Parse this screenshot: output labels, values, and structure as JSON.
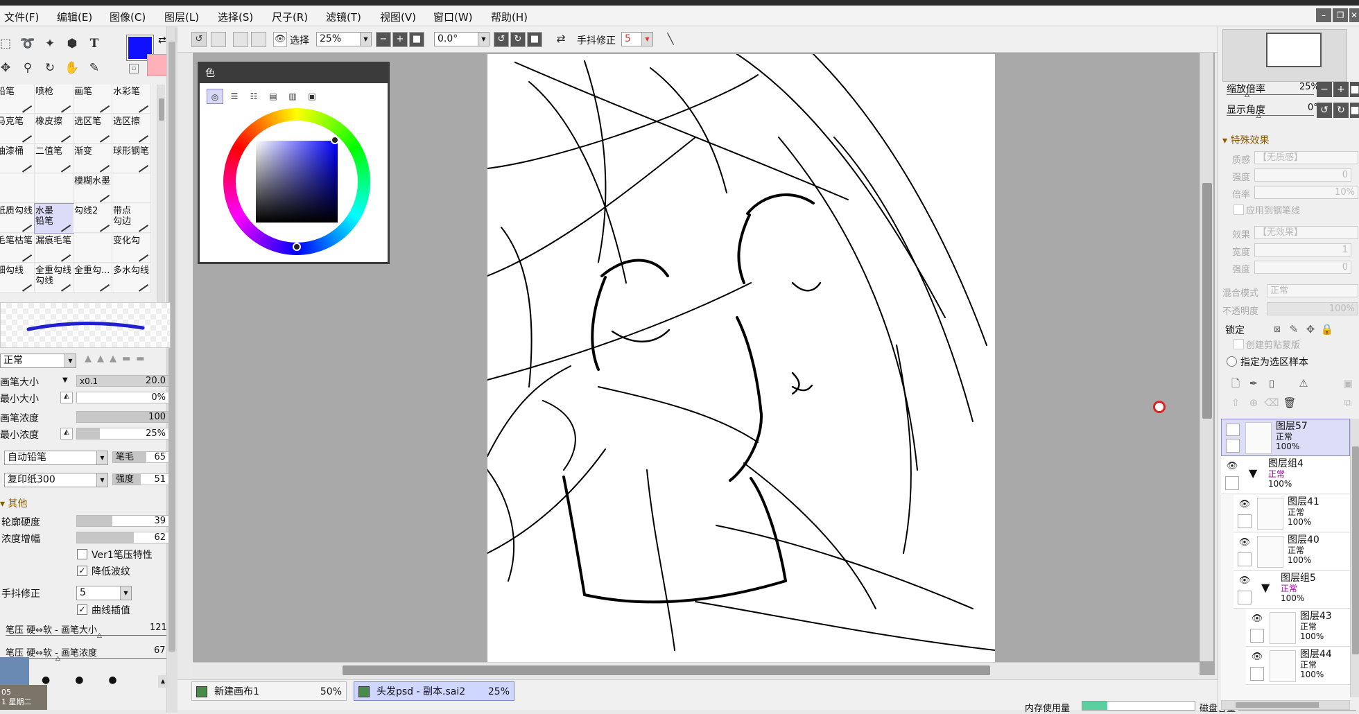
{
  "menu": [
    "文件(F)",
    "编辑(E)",
    "图像(C)",
    "图层(L)",
    "选择(S)",
    "尺子(R)",
    "滤镜(T)",
    "视图(V)",
    "窗口(W)",
    "帮助(H)"
  ],
  "window_buttons": [
    "–",
    "❐",
    "✕"
  ],
  "colors": {
    "foreground": "#1010ff",
    "background": "#ffb0b8"
  },
  "brushes": [
    {
      "label": "铅笔"
    },
    {
      "label": "喷枪"
    },
    {
      "label": "画笔"
    },
    {
      "label": "水彩笔"
    },
    {
      "label": "马克笔"
    },
    {
      "label": "橡皮擦"
    },
    {
      "label": "选区笔"
    },
    {
      "label": "选区擦"
    },
    {
      "label": "油漆桶"
    },
    {
      "label": "二值笔"
    },
    {
      "label": "渐变"
    },
    {
      "label": "球形钢笔"
    },
    {
      "label": ""
    },
    {
      "label": ""
    },
    {
      "label": "模糊水墨"
    },
    {
      "label": ""
    },
    {
      "label": "纸质勾线"
    },
    {
      "label": "水墨\n铅笔"
    },
    {
      "label": "勾线2"
    },
    {
      "label": "带点\n勾边"
    },
    {
      "label": "毛笔枯笔"
    },
    {
      "label": "漏痕毛笔"
    },
    {
      "label": ""
    },
    {
      "label": "变化勾"
    },
    {
      "label": "细勾线"
    },
    {
      "label": "全重勾线\n勾线"
    },
    {
      "label": "全重勾..."
    },
    {
      "label": "多水勾线"
    }
  ],
  "brush_settings": {
    "blend_mode": "正常",
    "size_label": "画笔大小",
    "size_mult": "x0.1",
    "size_value": "20.0",
    "min_size_label": "最小大小",
    "min_size_value": "0%",
    "density_label": "画笔浓度",
    "density_value": "100",
    "min_density_label": "最小浓度",
    "min_density_value": "25%",
    "pencil_type": "自动铅笔",
    "tip_label": "笔毛",
    "tip_value": "65",
    "paper": "复印纸300",
    "strength_label": "强度",
    "strength_value": "51",
    "other_header": "其他",
    "edge_hardness_label": "轮廓硬度",
    "edge_hardness_value": "39",
    "density_amp_label": "浓度增幅",
    "density_amp_value": "62",
    "ver1_label": "Ver1笔压特性",
    "reduce_ripple_label": "降低波纹",
    "stabilizer_label": "手抖修正",
    "stabilizer_value": "5",
    "curve_interp_label": "曲线插值",
    "pressure_size_label": "笔压 硬⇔软 - 画笔大小",
    "pressure_size_value": "121",
    "pressure_density_label": "笔压 硬⇔软 - 画笔浓度",
    "pressure_density_value": "67"
  },
  "taskbar_clock": {
    "time": "05",
    "day": "1 星期二"
  },
  "toolbar": {
    "select_label": "选择",
    "zoom": "25%",
    "angle": "0.0°",
    "stabilizer_label": "手抖修正",
    "stabilizer_value": "5"
  },
  "color_panel_title": "色",
  "status": {
    "docs": [
      {
        "name": "新建画布1",
        "zoom": "50%"
      },
      {
        "name": "头发psd - 副本.sai2",
        "zoom": "25%"
      }
    ],
    "memory_label": "内存使用量",
    "disk_label": "磁盘容量"
  },
  "navigator": {
    "zoom_label": "缩放倍率",
    "zoom_value": "25%",
    "angle_label": "显示角度",
    "angle_value": "0°"
  },
  "effects": {
    "header": "特殊效果",
    "texture_label": "质感",
    "texture_value": "【无质感】",
    "strength_label": "强度",
    "strength_value": "0",
    "scale_label": "倍率",
    "scale_value": "10%",
    "apply_pen_label": "应用到钢笔线",
    "effect_label": "效果",
    "effect_value": "【无效果】",
    "width_label": "宽度",
    "width_value": "1",
    "intensity_label": "强度",
    "intensity_value": "0",
    "blend_label": "混合模式",
    "blend_value": "正常",
    "opacity_label": "不透明度",
    "opacity_value": "100%",
    "lock_label": "锁定",
    "clip_label": "创建剪贴蒙版",
    "sample_label": "指定为选区样本"
  },
  "layers": [
    {
      "name": "图层57",
      "mode": "正常",
      "opacity": "100%",
      "indent": 0,
      "selected": true,
      "group": false
    },
    {
      "name": "图层组4",
      "mode": "正常",
      "opacity": "100%",
      "indent": 0,
      "selected": false,
      "group": true
    },
    {
      "name": "图层41",
      "mode": "正常",
      "opacity": "100%",
      "indent": 1,
      "selected": false,
      "group": false
    },
    {
      "name": "图层40",
      "mode": "正常",
      "opacity": "100%",
      "indent": 1,
      "selected": false,
      "group": false
    },
    {
      "name": "图层组5",
      "mode": "正常",
      "opacity": "100%",
      "indent": 1,
      "selected": false,
      "group": true
    },
    {
      "name": "图层43",
      "mode": "正常",
      "opacity": "100%",
      "indent": 2,
      "selected": false,
      "group": false
    },
    {
      "name": "图层44",
      "mode": "正常",
      "opacity": "100%",
      "indent": 2,
      "selected": false,
      "group": false
    }
  ]
}
